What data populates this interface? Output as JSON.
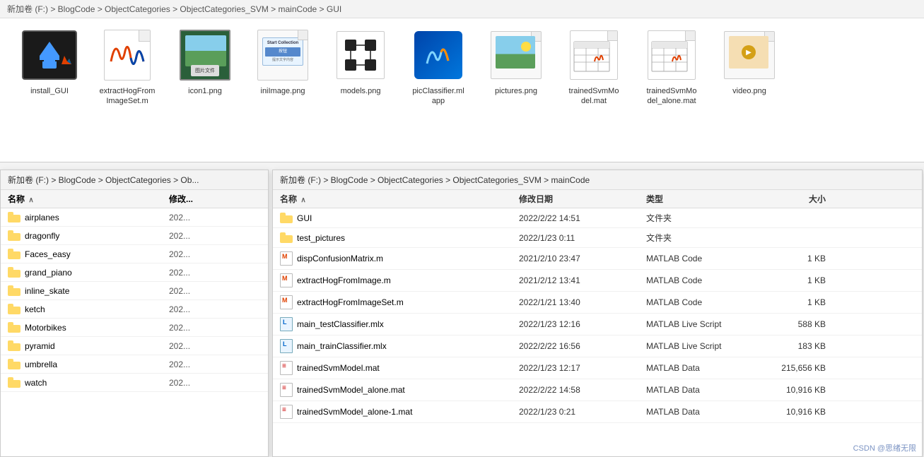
{
  "top_window": {
    "address": "新加卷 (F:) > BlogCode > ObjectCategories > ObjectCategories_SVM > mainCode > GUI",
    "parts": [
      "新加卷 (F:)",
      "BlogCode",
      "ObjectCategories",
      "ObjectCategories_SVM",
      "mainCode",
      "GUI"
    ],
    "icons": [
      {
        "id": "install_GUI",
        "label": "install_GUI",
        "type": "install-folder"
      },
      {
        "id": "extractHogFromImageSet",
        "label": "extractHogFrom\nImageSet.m",
        "type": "matlab"
      },
      {
        "id": "icon1",
        "label": "icon1.png",
        "type": "png-landscape"
      },
      {
        "id": "iniImage",
        "label": "iniImage.png",
        "type": "png-doc"
      },
      {
        "id": "models",
        "label": "models.png",
        "type": "png-models"
      },
      {
        "id": "picClassifier",
        "label": "picClassifier.ml\napp",
        "type": "mlapp"
      },
      {
        "id": "pictures",
        "label": "pictures.png",
        "type": "png-landscape2"
      },
      {
        "id": "trainedSvmModel",
        "label": "trainedSvmMo\ndel.mat",
        "type": "mat-table"
      },
      {
        "id": "trainedSvmModel_alone",
        "label": "trainedSvmMo\ndel_alone.mat",
        "type": "mat-table2"
      },
      {
        "id": "video",
        "label": "video.png",
        "type": "png-folder-img"
      }
    ]
  },
  "bottom_left": {
    "address": "新加卷 (F:) > BlogCode > ObjectCategories > Ob...",
    "cols": [
      "名称",
      "修改..."
    ],
    "rows": [
      {
        "name": "airplanes",
        "date": "202...",
        "type": "folder"
      },
      {
        "name": "dragonfly",
        "date": "202...",
        "type": "folder"
      },
      {
        "name": "Faces_easy",
        "date": "202...",
        "type": "folder"
      },
      {
        "name": "grand_piano",
        "date": "202...",
        "type": "folder"
      },
      {
        "name": "inline_skate",
        "date": "202...",
        "type": "folder"
      },
      {
        "name": "ketch",
        "date": "202...",
        "type": "folder"
      },
      {
        "name": "Motorbikes",
        "date": "202...",
        "type": "folder"
      },
      {
        "name": "pyramid",
        "date": "202...",
        "type": "folder"
      },
      {
        "name": "umbrella",
        "date": "202...",
        "type": "folder"
      },
      {
        "name": "watch",
        "date": "202...",
        "type": "folder"
      }
    ]
  },
  "bottom_right": {
    "address_parts": [
      "新加卷 (F:)",
      "BlogCode",
      "ObjectCategories",
      "ObjectCategories_SVM",
      "mainCode"
    ],
    "cols": {
      "name": "名称",
      "date": "修改日期",
      "type": "类型",
      "size": "大小"
    },
    "rows": [
      {
        "name": "GUI",
        "date": "2022/2/22 14:51",
        "type": "文件夹",
        "size": "",
        "file_type": "folder"
      },
      {
        "name": "test_pictures",
        "date": "2022/1/23 0:11",
        "type": "文件夹",
        "size": "",
        "file_type": "folder"
      },
      {
        "name": "dispConfusionMatrix.m",
        "date": "2021/2/10 23:47",
        "type": "MATLAB Code",
        "size": "1 KB",
        "file_type": "m"
      },
      {
        "name": "extractHogFromImage.m",
        "date": "2021/2/12 13:41",
        "type": "MATLAB Code",
        "size": "1 KB",
        "file_type": "m"
      },
      {
        "name": "extractHogFromImageSet.m",
        "date": "2022/1/21 13:40",
        "type": "MATLAB Code",
        "size": "1 KB",
        "file_type": "m"
      },
      {
        "name": "main_testClassifier.mlx",
        "date": "2022/1/23 12:16",
        "type": "MATLAB Live Script",
        "size": "588 KB",
        "file_type": "mlx"
      },
      {
        "name": "main_trainClassifier.mlx",
        "date": "2022/2/22 16:56",
        "type": "MATLAB Live Script",
        "size": "183 KB",
        "file_type": "mlx"
      },
      {
        "name": "trainedSvmModel.mat",
        "date": "2022/1/23 12:17",
        "type": "MATLAB Data",
        "size": "215,656 KB",
        "file_type": "mat"
      },
      {
        "name": "trainedSvmModel_alone.mat",
        "date": "2022/2/22 14:58",
        "type": "MATLAB Data",
        "size": "10,916 KB",
        "file_type": "mat"
      },
      {
        "name": "trainedSvmModel_alone-1.mat",
        "date": "2022/1/23 0:21",
        "type": "MATLAB Data",
        "size": "10,916 KB",
        "file_type": "mat"
      }
    ]
  },
  "watermark": "CSDN @思绪无限"
}
